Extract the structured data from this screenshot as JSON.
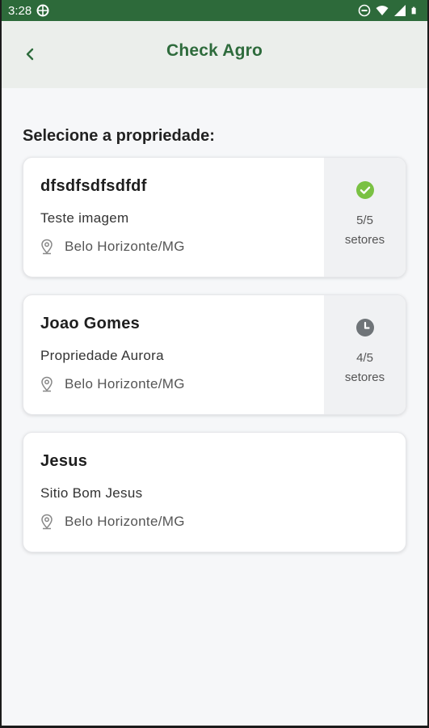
{
  "status_bar": {
    "time": "3:28"
  },
  "app_bar": {
    "title": "Check Agro"
  },
  "section_title": "Selecione a propriedade:",
  "properties": [
    {
      "name": "dfsdfsdfsdfdf",
      "property": "Teste imagem",
      "location": "Belo Horizonte/MG",
      "status": "complete",
      "status_icon": "check-circle-icon",
      "count": "5/5",
      "count_label": "setores",
      "status_color": "#7ac143"
    },
    {
      "name": "Joao Gomes",
      "property": "Propriedade Aurora",
      "location": "Belo Horizonte/MG",
      "status": "pending",
      "status_icon": "clock-icon",
      "count": "4/5",
      "count_label": "setores",
      "status_color": "#6f7478"
    },
    {
      "name": "Jesus",
      "property": "Sitio Bom Jesus",
      "location": "Belo Horizonte/MG"
    }
  ],
  "colors": {
    "status_bar": "#2d6a3a",
    "title": "#2e6b3c",
    "app_bar": "#ebeeeb"
  }
}
